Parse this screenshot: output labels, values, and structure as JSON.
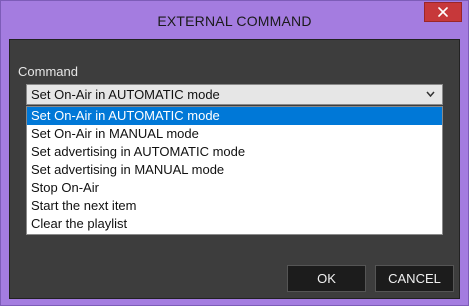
{
  "window": {
    "title": "EXTERNAL COMMAND"
  },
  "form": {
    "command_label": "Command",
    "command_selected": "Set On-Air in AUTOMATIC mode",
    "options": [
      "Set On-Air in AUTOMATIC mode",
      "Set On-Air in MANUAL mode",
      "Set advertising in AUTOMATIC mode",
      "Set advertising in MANUAL mode",
      "Stop On-Air",
      "Start the next item",
      "Clear the playlist"
    ],
    "highlighted_option_index": 0
  },
  "buttons": {
    "ok": "OK",
    "cancel": "CANCEL"
  },
  "colors": {
    "title_bar": "#a47ce0",
    "client_bg": "#3d3d3d",
    "close_button": "#c7383a",
    "selection": "#0078d7"
  },
  "icons": {
    "close": "close-icon",
    "dropdown": "chevron-down-icon"
  }
}
